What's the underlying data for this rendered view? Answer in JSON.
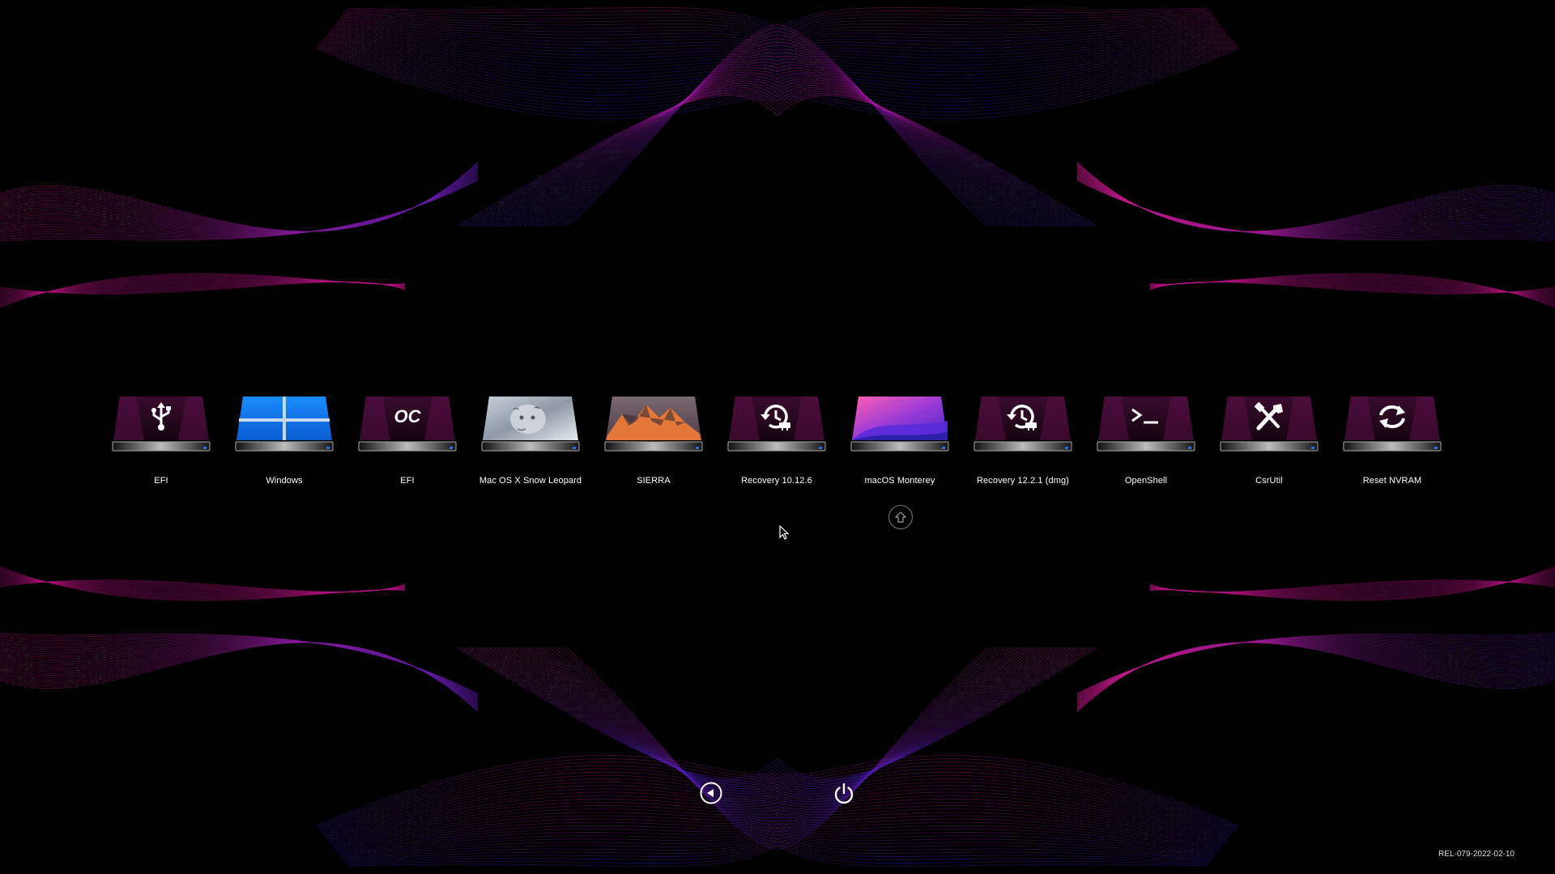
{
  "theme": {
    "accent": "#b0169a",
    "accent_blue": "#3a1fc4",
    "background": "#000000"
  },
  "boot_entries": [
    {
      "label": "EFI",
      "icon": "usb-icon",
      "style": "dark"
    },
    {
      "label": "Windows",
      "icon": "windows-logo-icon",
      "style": "windows"
    },
    {
      "label": "EFI",
      "icon": "opencore-oc-icon",
      "style": "dark"
    },
    {
      "label": "Mac OS X Snow Leopard",
      "icon": "snow-leopard-wallpaper-icon",
      "style": "snowleopard"
    },
    {
      "label": "SIERRA",
      "icon": "sierra-mountain-wallpaper-icon",
      "style": "sierra"
    },
    {
      "label": "Recovery 10.12.6",
      "icon": "recovery-clock-icon",
      "style": "dark"
    },
    {
      "label": "macOS Monterey",
      "icon": "monterey-wallpaper-icon",
      "style": "monterey"
    },
    {
      "label": "Recovery 12.2.1 (dmg)",
      "icon": "recovery-clock-icon",
      "style": "dark"
    },
    {
      "label": "OpenShell",
      "icon": "terminal-prompt-icon",
      "style": "dark"
    },
    {
      "label": "CsrUtil",
      "icon": "tools-icon",
      "style": "dark"
    },
    {
      "label": "Reset NVRAM",
      "icon": "refresh-icon",
      "style": "dark"
    }
  ],
  "selected_index": 6,
  "controls": {
    "back_icon": "back-arrow-icon",
    "power_icon": "power-icon"
  },
  "version": "REL-079-2022-02-10"
}
